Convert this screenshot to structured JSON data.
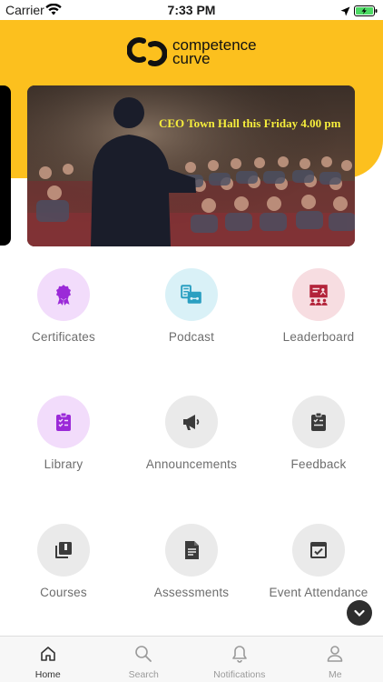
{
  "status_bar": {
    "carrier": "Carrier",
    "time": "7:33 PM"
  },
  "brand": {
    "line1": "competence",
    "line2": "curve",
    "accent_color": "#fcc01e"
  },
  "banner": {
    "caption": "CEO Town Hall this Friday 4.00 pm"
  },
  "grid": [
    {
      "label": "Certificates",
      "icon": "award-icon",
      "bg": "#f2dcfb",
      "fg": "#9b2ad8"
    },
    {
      "label": "Podcast",
      "icon": "podcast-icon",
      "bg": "#d9f1f7",
      "fg": "#2a9fc1"
    },
    {
      "label": "Leaderboard",
      "icon": "presentation-icon",
      "bg": "#f7dde1",
      "fg": "#b3233a"
    },
    {
      "label": "Library",
      "icon": "clipboard-icon",
      "bg": "#f2dcfb",
      "fg": "#9b2ad8"
    },
    {
      "label": "Announcements",
      "icon": "megaphone-icon",
      "bg": "#eaeaea",
      "fg": "#3b3b3b"
    },
    {
      "label": "Feedback",
      "icon": "clipboard-list-icon",
      "bg": "#eaeaea",
      "fg": "#3b3b3b"
    },
    {
      "label": "Courses",
      "icon": "library-books-icon",
      "bg": "#eaeaea",
      "fg": "#3b3b3b"
    },
    {
      "label": "Assessments",
      "icon": "document-icon",
      "bg": "#eaeaea",
      "fg": "#3b3b3b"
    },
    {
      "label": "Event Attendance",
      "icon": "calendar-check-icon",
      "bg": "#eaeaea",
      "fg": "#3b3b3b"
    }
  ],
  "tabs": [
    {
      "label": "Home",
      "icon": "home-icon",
      "active": true
    },
    {
      "label": "Search",
      "icon": "search-icon",
      "active": false
    },
    {
      "label": "Notifications",
      "icon": "bell-icon",
      "active": false
    },
    {
      "label": "Me",
      "icon": "person-icon",
      "active": false
    }
  ]
}
